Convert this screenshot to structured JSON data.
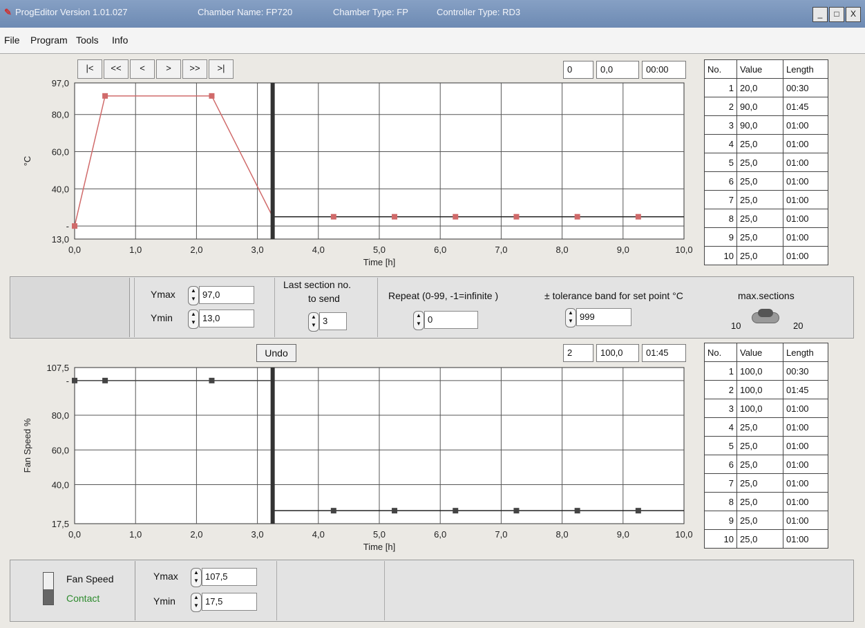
{
  "title": {
    "app": "ProgEditor Version 1.01.027",
    "chamber_name": "Chamber Name: FP720",
    "chamber_type": "Chamber Type: FP",
    "controller_type": "Controller Type: RD3",
    "min": "_",
    "max": "□",
    "close": "X"
  },
  "menu": [
    "File",
    "Program",
    "Tools",
    "Info"
  ],
  "nav": [
    "|<",
    "<<",
    "<",
    ">",
    ">>",
    ">|"
  ],
  "temp_readout": {
    "section": "0",
    "value": "0,0",
    "time": "00:00"
  },
  "fan_readout": {
    "section": "2",
    "value": "100,0",
    "time": "01:45"
  },
  "undo": "Undo",
  "table_headers": [
    "No.",
    "Value",
    "Length"
  ],
  "temp_table": [
    [
      "1",
      "20,0",
      "00:30"
    ],
    [
      "2",
      "90,0",
      "01:45"
    ],
    [
      "3",
      "90,0",
      "01:00"
    ],
    [
      "4",
      "25,0",
      "01:00"
    ],
    [
      "5",
      "25,0",
      "01:00"
    ],
    [
      "6",
      "25,0",
      "01:00"
    ],
    [
      "7",
      "25,0",
      "01:00"
    ],
    [
      "8",
      "25,0",
      "01:00"
    ],
    [
      "9",
      "25,0",
      "01:00"
    ],
    [
      "10",
      "25,0",
      "01:00"
    ]
  ],
  "fan_table": [
    [
      "1",
      "100,0",
      "00:30"
    ],
    [
      "2",
      "100,0",
      "01:45"
    ],
    [
      "3",
      "100,0",
      "01:00"
    ],
    [
      "4",
      "25,0",
      "01:00"
    ],
    [
      "5",
      "25,0",
      "01:00"
    ],
    [
      "6",
      "25,0",
      "01:00"
    ],
    [
      "7",
      "25,0",
      "01:00"
    ],
    [
      "8",
      "25,0",
      "01:00"
    ],
    [
      "9",
      "25,0",
      "01:00"
    ],
    [
      "10",
      "25,0",
      "01:00"
    ]
  ],
  "mid_panel": {
    "ymax_label": "Ymax",
    "ymax": "97,0",
    "ymin_label": "Ymin",
    "ymin": "13,0",
    "last_section_label1": "Last section no.",
    "last_section_label2": "to send",
    "last_section": "3",
    "repeat_label": "Repeat (0-99, -1=infinite )",
    "repeat": "0",
    "tolerance_label": "± tolerance band for set point °C",
    "tolerance": "999",
    "max_sections_label": "max.sections",
    "max_sections_low": "10",
    "max_sections_high": "20"
  },
  "bottom_panel": {
    "fan_speed": "Fan Speed",
    "contact": "Contact",
    "ymax_label": "Ymax",
    "ymax": "107,5",
    "ymin_label": "Ymin",
    "ymin": "17,5"
  },
  "chart_data": [
    {
      "type": "line",
      "title": "",
      "xlabel": "Time  [h]",
      "ylabel": "°C",
      "xlim": [
        0,
        10
      ],
      "ylim": [
        13,
        97
      ],
      "xticks": [
        "0,0",
        "1,0",
        "2,0",
        "3,0",
        "4,0",
        "5,0",
        "6,0",
        "7,0",
        "8,0",
        "9,0",
        "10,0"
      ],
      "yticks": [
        {
          "v": 97,
          "t": "97,0"
        },
        {
          "v": 80,
          "t": "80,0"
        },
        {
          "v": 60,
          "t": "60,0"
        },
        {
          "v": 40,
          "t": "40,0"
        },
        {
          "v": 20,
          "t": "-"
        },
        {
          "v": 13,
          "t": "13,0"
        }
      ],
      "marker_x": 3.25,
      "color": "#d06a6a",
      "sent_series": {
        "x": [
          0,
          0.5,
          2.25,
          3.25
        ],
        "y": [
          20,
          90,
          90,
          25
        ]
      },
      "unsent_series": {
        "x": [
          3.25,
          4.25,
          5.25,
          6.25,
          7.25,
          8.25,
          9.25,
          10
        ],
        "y": [
          25,
          25,
          25,
          25,
          25,
          25,
          25,
          25
        ]
      },
      "points": {
        "x": [
          0,
          0.5,
          2.25,
          4.25,
          5.25,
          6.25,
          7.25,
          8.25,
          9.25
        ],
        "y": [
          20,
          90,
          90,
          25,
          25,
          25,
          25,
          25,
          25
        ]
      }
    },
    {
      "type": "line",
      "title": "",
      "xlabel": "Time  [h]",
      "ylabel": "Fan Speed %",
      "xlim": [
        0,
        10
      ],
      "ylim": [
        17.5,
        107.5
      ],
      "xticks": [
        "0,0",
        "1,0",
        "2,0",
        "3,0",
        "4,0",
        "5,0",
        "6,0",
        "7,0",
        "8,0",
        "9,0",
        "10,0"
      ],
      "yticks": [
        {
          "v": 107.5,
          "t": "107,5"
        },
        {
          "v": 100,
          "t": "-"
        },
        {
          "v": 80,
          "t": "80,0"
        },
        {
          "v": 60,
          "t": "60,0"
        },
        {
          "v": 40,
          "t": "40,0"
        },
        {
          "v": 17.5,
          "t": "17,5"
        }
      ],
      "marker_x": 3.25,
      "color": "#444444",
      "sent_series": {
        "x": [
          0,
          0.5,
          2.25,
          3.25
        ],
        "y": [
          100,
          100,
          100,
          100
        ]
      },
      "unsent_series": {
        "x": [
          3.25,
          4.25,
          5.25,
          6.25,
          7.25,
          8.25,
          9.25,
          10
        ],
        "y": [
          25,
          25,
          25,
          25,
          25,
          25,
          25,
          25
        ]
      },
      "points": {
        "x": [
          0,
          0.5,
          2.25,
          4.25,
          5.25,
          6.25,
          7.25,
          8.25,
          9.25
        ],
        "y": [
          100,
          100,
          100,
          25,
          25,
          25,
          25,
          25,
          25
        ]
      }
    }
  ]
}
